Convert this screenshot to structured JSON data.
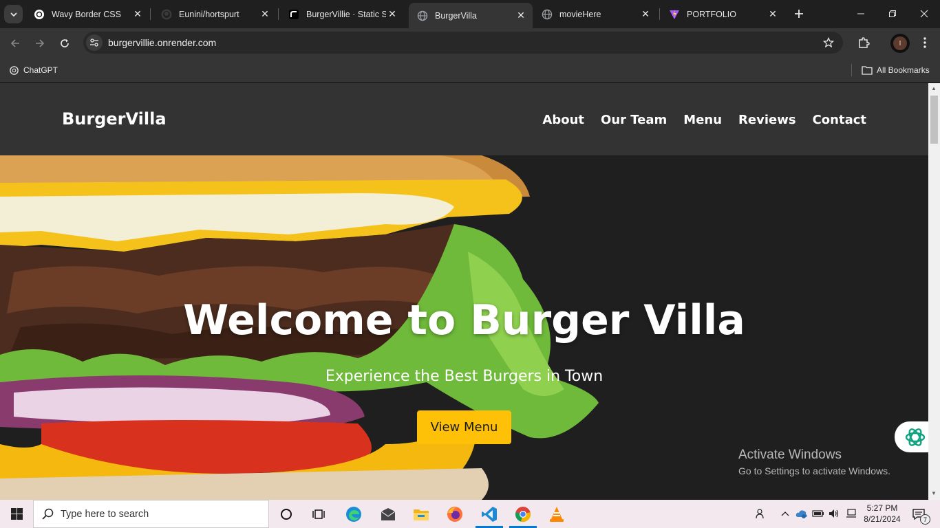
{
  "browser": {
    "tabs": [
      {
        "title": "Wavy Border CSS",
        "icon": "chatgpt-icon"
      },
      {
        "title": "Eunini/hortspurt",
        "icon": "github-icon"
      },
      {
        "title": "BurgerVillie · Static Si",
        "icon": "render-icon"
      },
      {
        "title": "BurgerVilla",
        "icon": "globe-icon"
      },
      {
        "title": "movieHere",
        "icon": "globe-icon"
      },
      {
        "title": "PORTFOLIO",
        "icon": "vite-icon"
      }
    ],
    "active_tab_index": 3,
    "url": "burgervillie.onrender.com",
    "profile_initial": "I",
    "bookmarks": {
      "left": [
        {
          "label": "ChatGPT"
        }
      ],
      "all_bookmarks": "All Bookmarks"
    }
  },
  "site": {
    "logo": "BurgerVilla",
    "nav": [
      "About",
      "Our Team",
      "Menu",
      "Reviews",
      "Contact"
    ],
    "hero": {
      "title": "Welcome to Burger Villa",
      "subtitle": "Experience the Best Burgers in Town",
      "cta": "View Menu"
    },
    "colors": {
      "header_bg": "#333333",
      "hero_bg": "#1f1f1f",
      "cta_bg": "#ffc107"
    }
  },
  "overlay": {
    "activate_title": "Activate Windows",
    "activate_sub": "Go to Settings to activate Windows."
  },
  "taskbar": {
    "search_placeholder": "Type here to search",
    "time": "5:27 PM",
    "date": "8/21/2024",
    "notification_count": "7",
    "pinned": [
      "cortana-icon",
      "task-view-icon",
      "edge-icon",
      "mail-icon",
      "file-explorer-icon",
      "firefox-icon",
      "vscode-icon",
      "chrome-icon",
      "vlc-icon"
    ]
  }
}
